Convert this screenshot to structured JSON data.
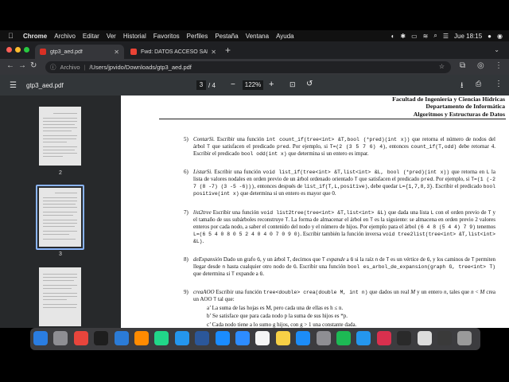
{
  "menubar": {
    "app": "Chrome",
    "items": [
      "Archivo",
      "Editar",
      "Ver",
      "Historial",
      "Favoritos",
      "Perfiles",
      "Pestaña",
      "Ventana",
      "Ayuda"
    ],
    "clock": "Jue 18:15"
  },
  "tabs": [
    {
      "label": "gtp3_aed.pdf",
      "active": true
    },
    {
      "label": "Fwd: DATOS ACCESO SALA M...",
      "active": false
    }
  ],
  "toolbar": {
    "url_scheme": "Archivo",
    "url": "/Users/jpvido/Downloads/gtp3_aed.pdf"
  },
  "pdf": {
    "title": "gtp3_aed.pdf",
    "page_current": "3",
    "page_total": "/  4",
    "zoom": "122%"
  },
  "thumbs": [
    "2",
    "3"
  ],
  "header": {
    "line1": "Facultad de Ingeniería y Ciencias Hídricas",
    "line2": "Departamento de Informática",
    "line3": "Algoritmos y Estructuras de Datos"
  },
  "exercises": [
    {
      "num": "5)",
      "html": "<i>ContarSi.</i> Escribir una función <code>int count_if(tree&lt;int&gt; &amp;T,bool (*pred)(int x))</code> que retorna el número de nodos del árbol <code>T</code> que satisfacen el predicado <code>pred</code>. Por ejemplo, si <code>T=(2 (3 5 7 6) 4)</code>, entonces <code>count_if(T,odd)</code> debe retornar 4. Escribir el predicado <code>bool odd(int x)</code> que determina si un entero es impar."
    },
    {
      "num": "6)",
      "html": "<i>ListarSi.</i> Escribir una función <code>void list_if(tree&lt;int&gt; &amp;T,list&lt;int&gt; &amp;L, bool (*pred)(int x))</code> que retorna en <code>L</code> la lista de valores nodales en orden previo de un árbol ordenado orientado <code>T</code> que satisfacen el predicado <code>pred</code>. Por ejemplo, si <code>T=(1 (-2 7 (8 -7) (3 -5 -6)))</code>, entonces después de <code>list_if(T,L,positive)</code>, debe quedar <code>L={1,7,8,3}</code>. Escribir el predicado <code>bool positive(int x)</code> que determina si un entero es mayor que 0."
    },
    {
      "num": "7)",
      "html": "<i>list2tree</i> Escribir una función <code>void list2tree(tree&lt;int&gt; &amp;T,list&lt;int&gt; &amp;L)</code> que dada una lista <code>L</code> con el orden previo de <code>T</code> y el tamaño de sus subárboles reconstruye <code>T</code>. La forma de almacenar el árbol en <code>T</code> es la siguiente: se almacena en orden previo 2 valores enteros por cada nodo, a saber el contenido del nodo y el número de hijos. Por ejemplo para el árbol <code>(6 4 8 (5 4 4) 7 9)</code> tenemos <code>L=(6 5 4 0 8 0 5 2 4 0 4 0 7 0 9 0)</code>. Escribir también la función inversa <code>void tree2list(tree&lt;int&gt; &amp;T,list&lt;int&gt; &amp;L)</code>."
    },
    {
      "num": "8)",
      "html": "<i>deExpansión</i> Dado un grafo <code>G</code>, y un árbol <code>T</code>, decimos que <code>T</code> <i>expande</i> a <code>G</code> si la raíz <code>n</code> de <code>T</code> es un vértice de <code>G</code>, y los caminos de <code>T</code> permiten llegar desde <code>n</code> hasta cualquier otro nodo de <code>G</code>. Escribir una función <code>bool es_arbol_de_expansion(graph G, tree&lt;int&gt; T)</code> que determina si <code>T</code> expande a <code>G</code>."
    },
    {
      "num": "9)",
      "html": "<i>creaAOO</i> Escribir una función <code>tree&lt;double&gt; crea(double M, int n)</code> que dados un real <i>M</i> y un entero <i>n</i>, tales que <i>n</i> &lt; <i>M</i> crea un AOO <code>T</code> tal que:"
    }
  ],
  "subitems": [
    "a’  La suma de las hojas es M, pero cada una de ellas es h ≤ n.",
    "b’  Se satisface que para cada nodo p la suma de sus hijos es *p.",
    "c’  Cada nodo tiene a lo sumo g hijos, con g > 1 una constante dada."
  ],
  "dock": [
    "Finder",
    "Launchpad",
    "Chrome",
    "Terminal",
    "VS Code",
    "Sublime",
    "PyCharm",
    "Docker",
    "Word",
    "Safari",
    "Zoom",
    "Calendar",
    "Notes",
    "App Store",
    "Settings",
    "Spotify",
    "Docker",
    "CLion",
    "Console",
    "Files",
    "Screen",
    "Trash"
  ],
  "colors": {
    "accent": "#8ab4f8",
    "chrome_dark": "#35363a",
    "pdf_bg": "#525659"
  }
}
